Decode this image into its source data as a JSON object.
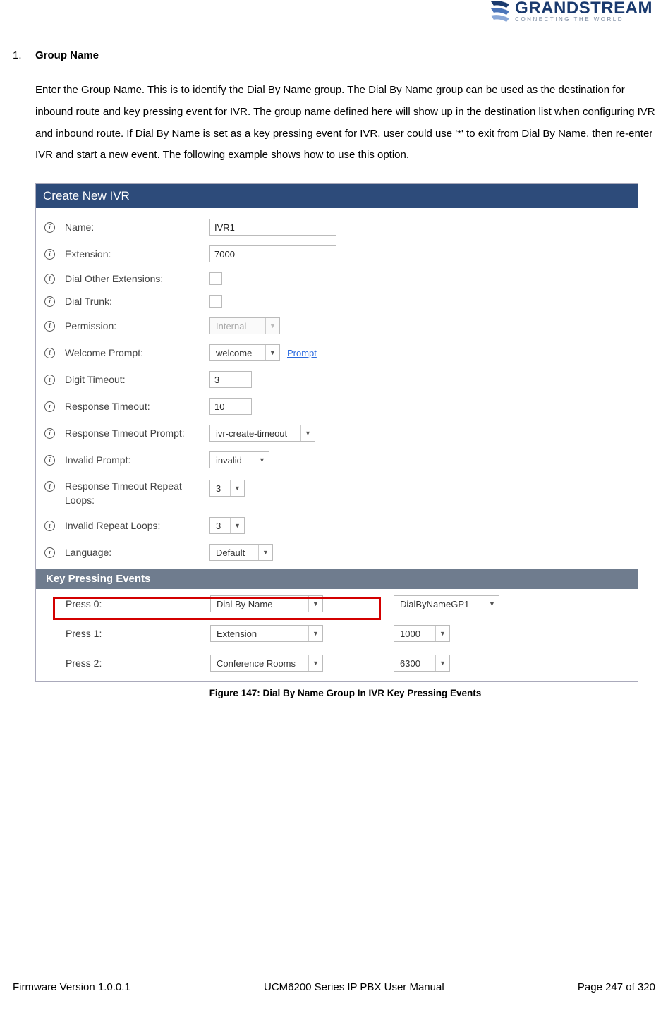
{
  "logo": {
    "brand": "GRANDSTREAM",
    "tagline": "CONNECTING THE WORLD"
  },
  "section": {
    "num": "1.",
    "title": "Group Name",
    "body": "Enter the Group Name. This is to identify the Dial By Name group. The Dial By Name group can be used as the destination for inbound route and key pressing event for IVR. The group name defined here will show up in the destination list when configuring IVR and inbound route. If Dial By Name is set as a key pressing event for IVR, user could use '*' to exit from Dial By Name, then re-enter IVR and start a new event. The following example shows how to use this option."
  },
  "ivr": {
    "title": "Create New IVR",
    "rows": {
      "name": {
        "label": "Name:",
        "value": "IVR1"
      },
      "extension": {
        "label": "Extension:",
        "value": "7000"
      },
      "dialOther": {
        "label": "Dial Other Extensions:"
      },
      "dialTrunk": {
        "label": "Dial Trunk:"
      },
      "permission": {
        "label": "Permission:",
        "value": "Internal"
      },
      "welcome": {
        "label": "Welcome Prompt:",
        "value": "welcome",
        "link": "Prompt"
      },
      "digitTimeout": {
        "label": "Digit Timeout:",
        "value": "3"
      },
      "responseTimeout": {
        "label": "Response Timeout:",
        "value": "10"
      },
      "respTimeoutPrompt": {
        "label": "Response Timeout Prompt:",
        "value": "ivr-create-timeout"
      },
      "invalidPrompt": {
        "label": "Invalid Prompt:",
        "value": "invalid"
      },
      "respRepeat": {
        "label": "Response Timeout Repeat Loops:",
        "value": "3"
      },
      "invalidRepeat": {
        "label": "Invalid Repeat Loops:",
        "value": "3"
      },
      "language": {
        "label": "Language:",
        "value": "Default"
      }
    },
    "keySection": "Key Pressing Events",
    "keys": [
      {
        "label": "Press 0:",
        "type": "Dial By Name",
        "dest": "DialByNameGP1"
      },
      {
        "label": "Press 1:",
        "type": "Extension",
        "dest": "1000"
      },
      {
        "label": "Press 2:",
        "type": "Conference Rooms",
        "dest": "6300"
      }
    ]
  },
  "caption": "Figure 147: Dial By Name Group In IVR Key Pressing Events",
  "footer": {
    "left": "Firmware Version 1.0.0.1",
    "center": "UCM6200 Series IP PBX User Manual",
    "right": "Page 247 of 320"
  }
}
